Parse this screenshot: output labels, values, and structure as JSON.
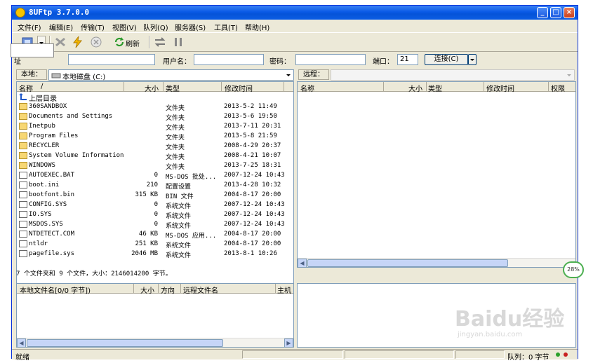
{
  "window": {
    "title": "8UFtp 3.7.0.0"
  },
  "menu": [
    "文件(F)",
    "编辑(E)",
    "传输(T)",
    "视图(V)",
    "队列(Q)",
    "服务器(S)",
    "工具(T)",
    "帮助(H)"
  ],
  "toolbar": {
    "refresh_label": "刷新"
  },
  "connect": {
    "host_label": "址",
    "user_label": "用户名：",
    "password_label": "密码：",
    "port_label": "端口：",
    "port_value": "21",
    "connect_button": "连接(C)"
  },
  "local": {
    "label": "本地：",
    "path": "本地磁盘 (C:)",
    "columns": [
      "名称",
      "大小",
      "类型",
      "修改时间"
    ],
    "sort_indicator": "/",
    "parent_label": "上层目录",
    "files": [
      {
        "name": "360SANDBOX",
        "size": "",
        "type": "文件夹",
        "date": "2013-5-2 11:49",
        "icon": "folder"
      },
      {
        "name": "Documents and Settings",
        "size": "",
        "type": "文件夹",
        "date": "2013-5-6 19:50",
        "icon": "folder"
      },
      {
        "name": "Inetpub",
        "size": "",
        "type": "文件夹",
        "date": "2013-7-11 20:31",
        "icon": "folder"
      },
      {
        "name": "Program Files",
        "size": "",
        "type": "文件夹",
        "date": "2013-5-8 21:59",
        "icon": "folder"
      },
      {
        "name": "RECYCLER",
        "size": "",
        "type": "文件夹",
        "date": "2008-4-29 20:37",
        "icon": "folder"
      },
      {
        "name": "System Volume Information",
        "size": "",
        "type": "文件夹",
        "date": "2008-4-21 10:07",
        "icon": "folder"
      },
      {
        "name": "WINDOWS",
        "size": "",
        "type": "文件夹",
        "date": "2013-7-25 18:31",
        "icon": "folder"
      },
      {
        "name": "AUTOEXEC.BAT",
        "size": "0",
        "type": "MS-DOS 批处...",
        "date": "2007-12-24 10:43",
        "icon": "file"
      },
      {
        "name": "boot.ini",
        "size": "210",
        "type": "配置设置",
        "date": "2013-4-28 10:32",
        "icon": "file"
      },
      {
        "name": "bootfont.bin",
        "size": "315 KB",
        "type": "BIN 文件",
        "date": "2004-8-17 20:00",
        "icon": "file"
      },
      {
        "name": "CONFIG.SYS",
        "size": "0",
        "type": "系统文件",
        "date": "2007-12-24 10:43",
        "icon": "file"
      },
      {
        "name": "IO.SYS",
        "size": "0",
        "type": "系统文件",
        "date": "2007-12-24 10:43",
        "icon": "file"
      },
      {
        "name": "MSDOS.SYS",
        "size": "0",
        "type": "系统文件",
        "date": "2007-12-24 10:43",
        "icon": "file"
      },
      {
        "name": "NTDETECT.COM",
        "size": "46 KB",
        "type": "MS-DOS 应用...",
        "date": "2004-8-17 20:00",
        "icon": "file"
      },
      {
        "name": "ntldr",
        "size": "251 KB",
        "type": "系统文件",
        "date": "2004-8-17 20:00",
        "icon": "file"
      },
      {
        "name": "pagefile.sys",
        "size": "2046 MB",
        "type": "系统文件",
        "date": "2013-8-1 10:26",
        "icon": "file"
      }
    ],
    "summary": "7 个文件夹和 9 个文件，大小：2146014200 字节。"
  },
  "remote": {
    "label": "远程：",
    "columns": [
      "名称",
      "大小",
      "类型",
      "修改时间",
      "权限"
    ]
  },
  "queue": {
    "columns": [
      "本地文件名[0/0 字节])",
      "大小",
      "方向",
      "远程文件名",
      "主机"
    ]
  },
  "status": {
    "ready": "就绪",
    "queue": "队列：0 字节"
  },
  "overlay": {
    "progress": "28%",
    "watermark": "Baidu经验",
    "watermark_url": "jingyan.baidu.com"
  },
  "colors": {
    "title_bar": "#0a5ae6",
    "chrome": "#ece9d8",
    "border": "#7f9db9"
  }
}
